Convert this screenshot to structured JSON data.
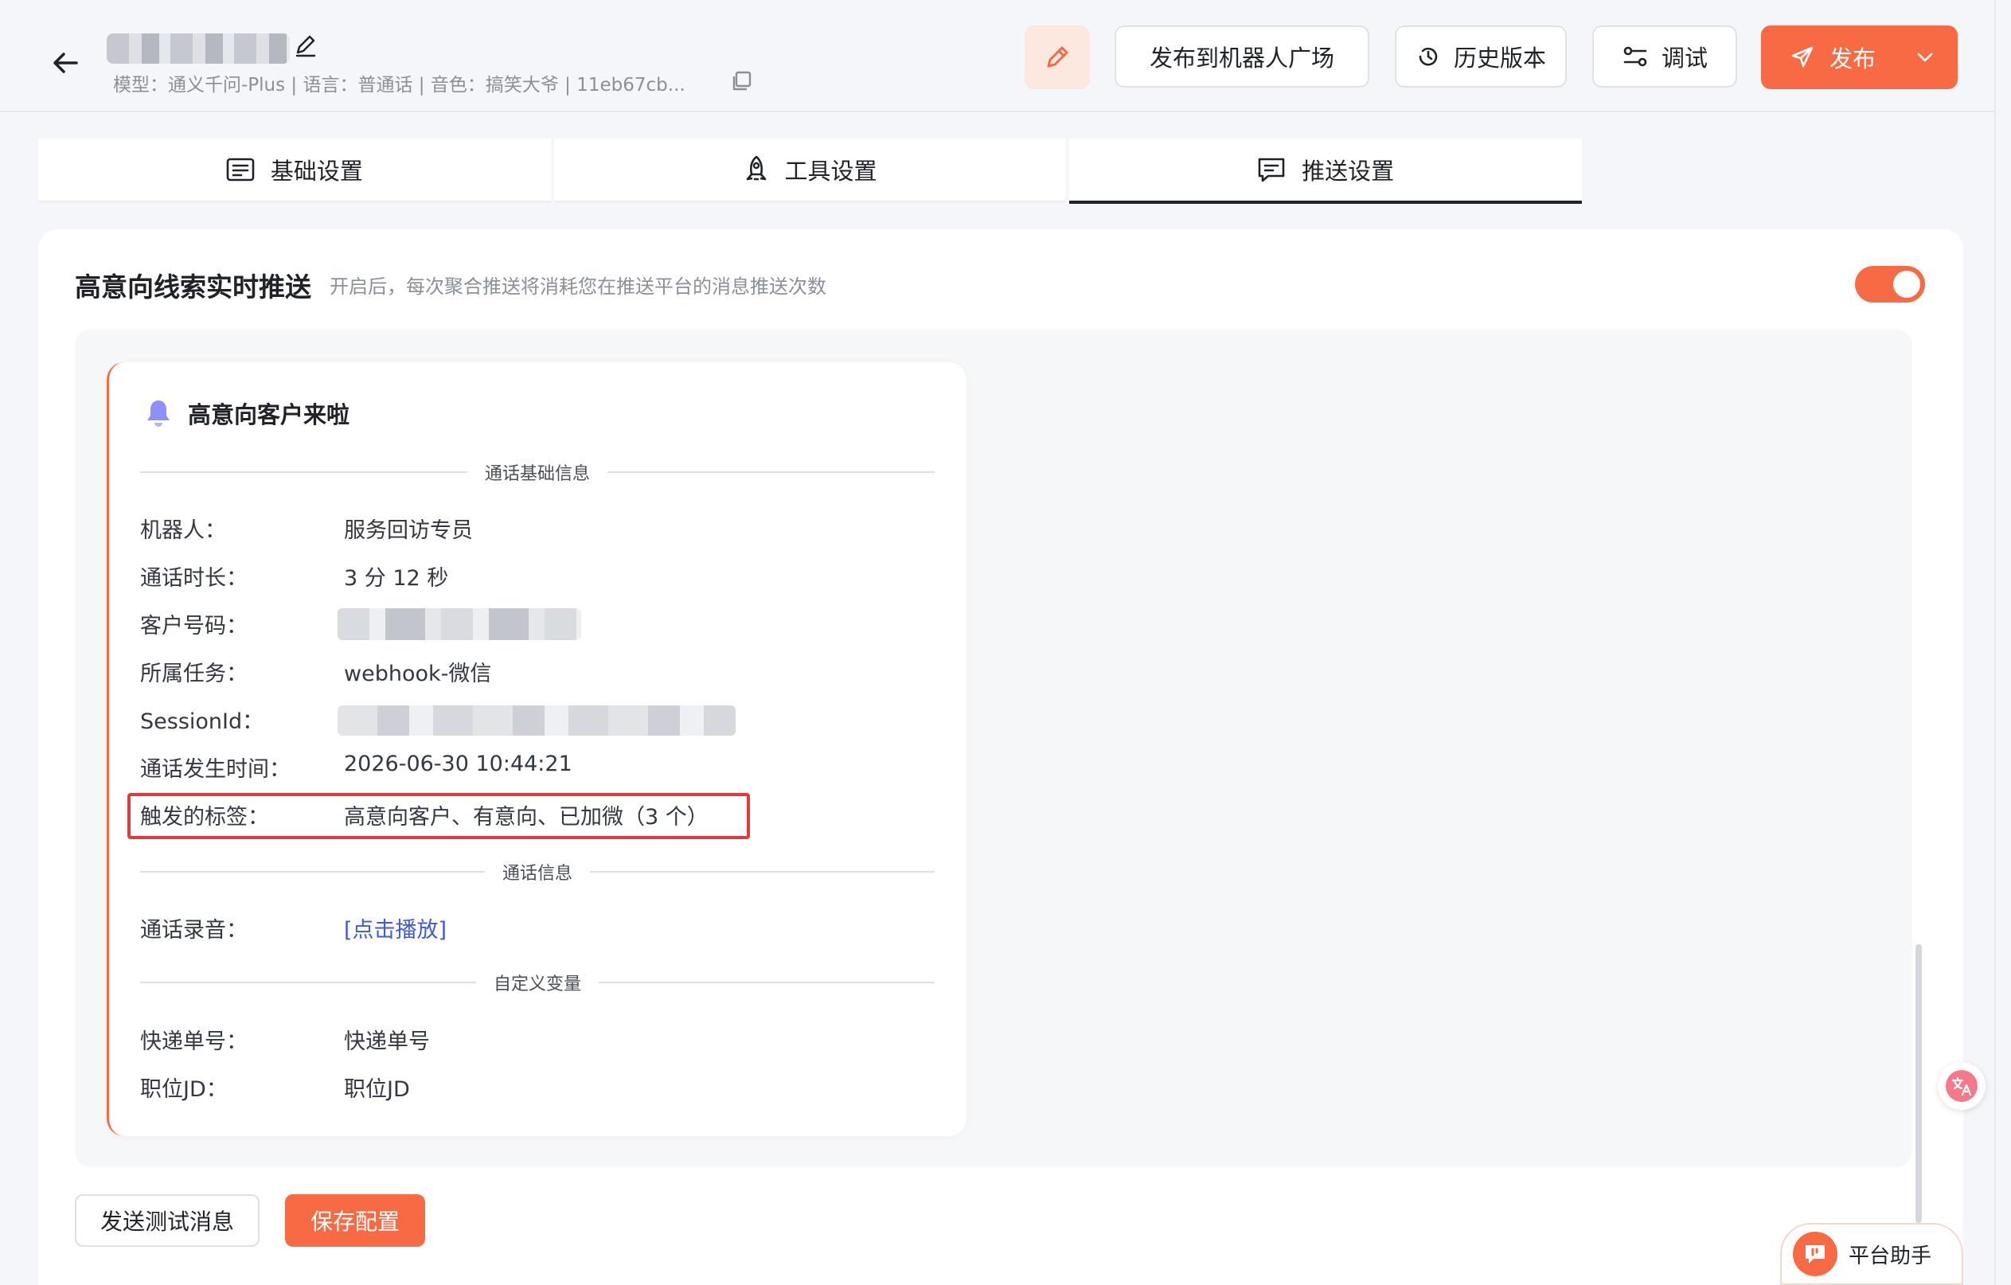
{
  "header": {
    "meta_line": "模型：通义千问-Plus  |  语言：普通话  |  音色：搞笑大爷 | 11eb67cb...",
    "publish_square_label": "发布到机器人广场",
    "history_label": "历史版本",
    "debug_label": "调试",
    "publish_label": "发布"
  },
  "tabs": [
    {
      "label": "基础设置",
      "icon": "list-icon"
    },
    {
      "label": "工具设置",
      "icon": "rocket-icon"
    },
    {
      "label": "推送设置",
      "icon": "message-icon",
      "active": true
    }
  ],
  "push": {
    "title": "高意向线索实时推送",
    "description": "开启后，每次聚合推送将消耗您在推送平台的消息推送次数",
    "enabled": true
  },
  "message": {
    "title": "高意向客户来啦",
    "sections": {
      "basic": "通话基础信息",
      "call": "通话信息",
      "custom": "自定义变量"
    },
    "rows": {
      "robot": {
        "label": "机器人：",
        "value": "服务回访专员"
      },
      "duration": {
        "label": "通话时长：",
        "value": "3 分 12 秒"
      },
      "phone": {
        "label": "客户号码：",
        "value": ""
      },
      "task": {
        "label": "所属任务：",
        "value": "webhook-微信"
      },
      "session": {
        "label": "SessionId：",
        "value": ""
      },
      "time": {
        "label": "通话发生时间：",
        "value": "2026-06-30 10:44:21"
      },
      "tags": {
        "label": "触发的标签：",
        "value": "高意向客户、有意向、已加微（3 个）"
      },
      "recording": {
        "label": "通话录音：",
        "value": "[点击播放]"
      },
      "express": {
        "label": "快递单号：",
        "value": "快递单号"
      },
      "job": {
        "label": "职位JD：",
        "value": "职位JD"
      }
    }
  },
  "actions": {
    "send_test": "发送测试消息",
    "save": "保存配置"
  },
  "assistant": {
    "label": "平台助手"
  },
  "colors": {
    "accent": "#f76a43",
    "link": "#3b5bdb",
    "highlight": "#e23a3a"
  }
}
